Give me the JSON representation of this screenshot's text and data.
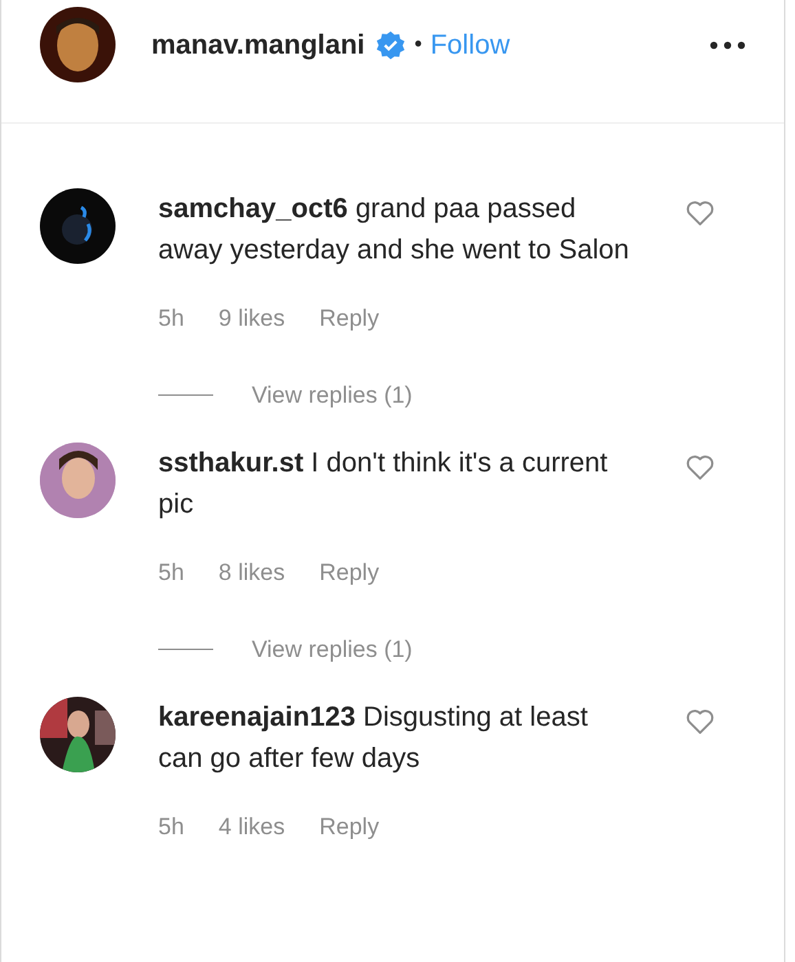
{
  "post_header": {
    "username": "manav.manglani",
    "verified": true,
    "separator": "•",
    "follow_label": "Follow"
  },
  "comments": [
    {
      "username": "samchay_oct6",
      "text": "grand paa passed away yesterday and she went to Salon",
      "time": "5h",
      "likes": "9 likes",
      "reply_label": "Reply",
      "liked": false,
      "view_replies": "View replies (1)"
    },
    {
      "username": "ssthakur.st",
      "text": "I don't think it's a current pic",
      "time": "5h",
      "likes": "8 likes",
      "reply_label": "Reply",
      "liked": false,
      "view_replies": "View replies (1)"
    },
    {
      "username": "kareenajain123",
      "text": "Disgusting at least can go after few days",
      "time": "5h",
      "likes": "4 likes",
      "reply_label": "Reply",
      "liked": false
    }
  ]
}
